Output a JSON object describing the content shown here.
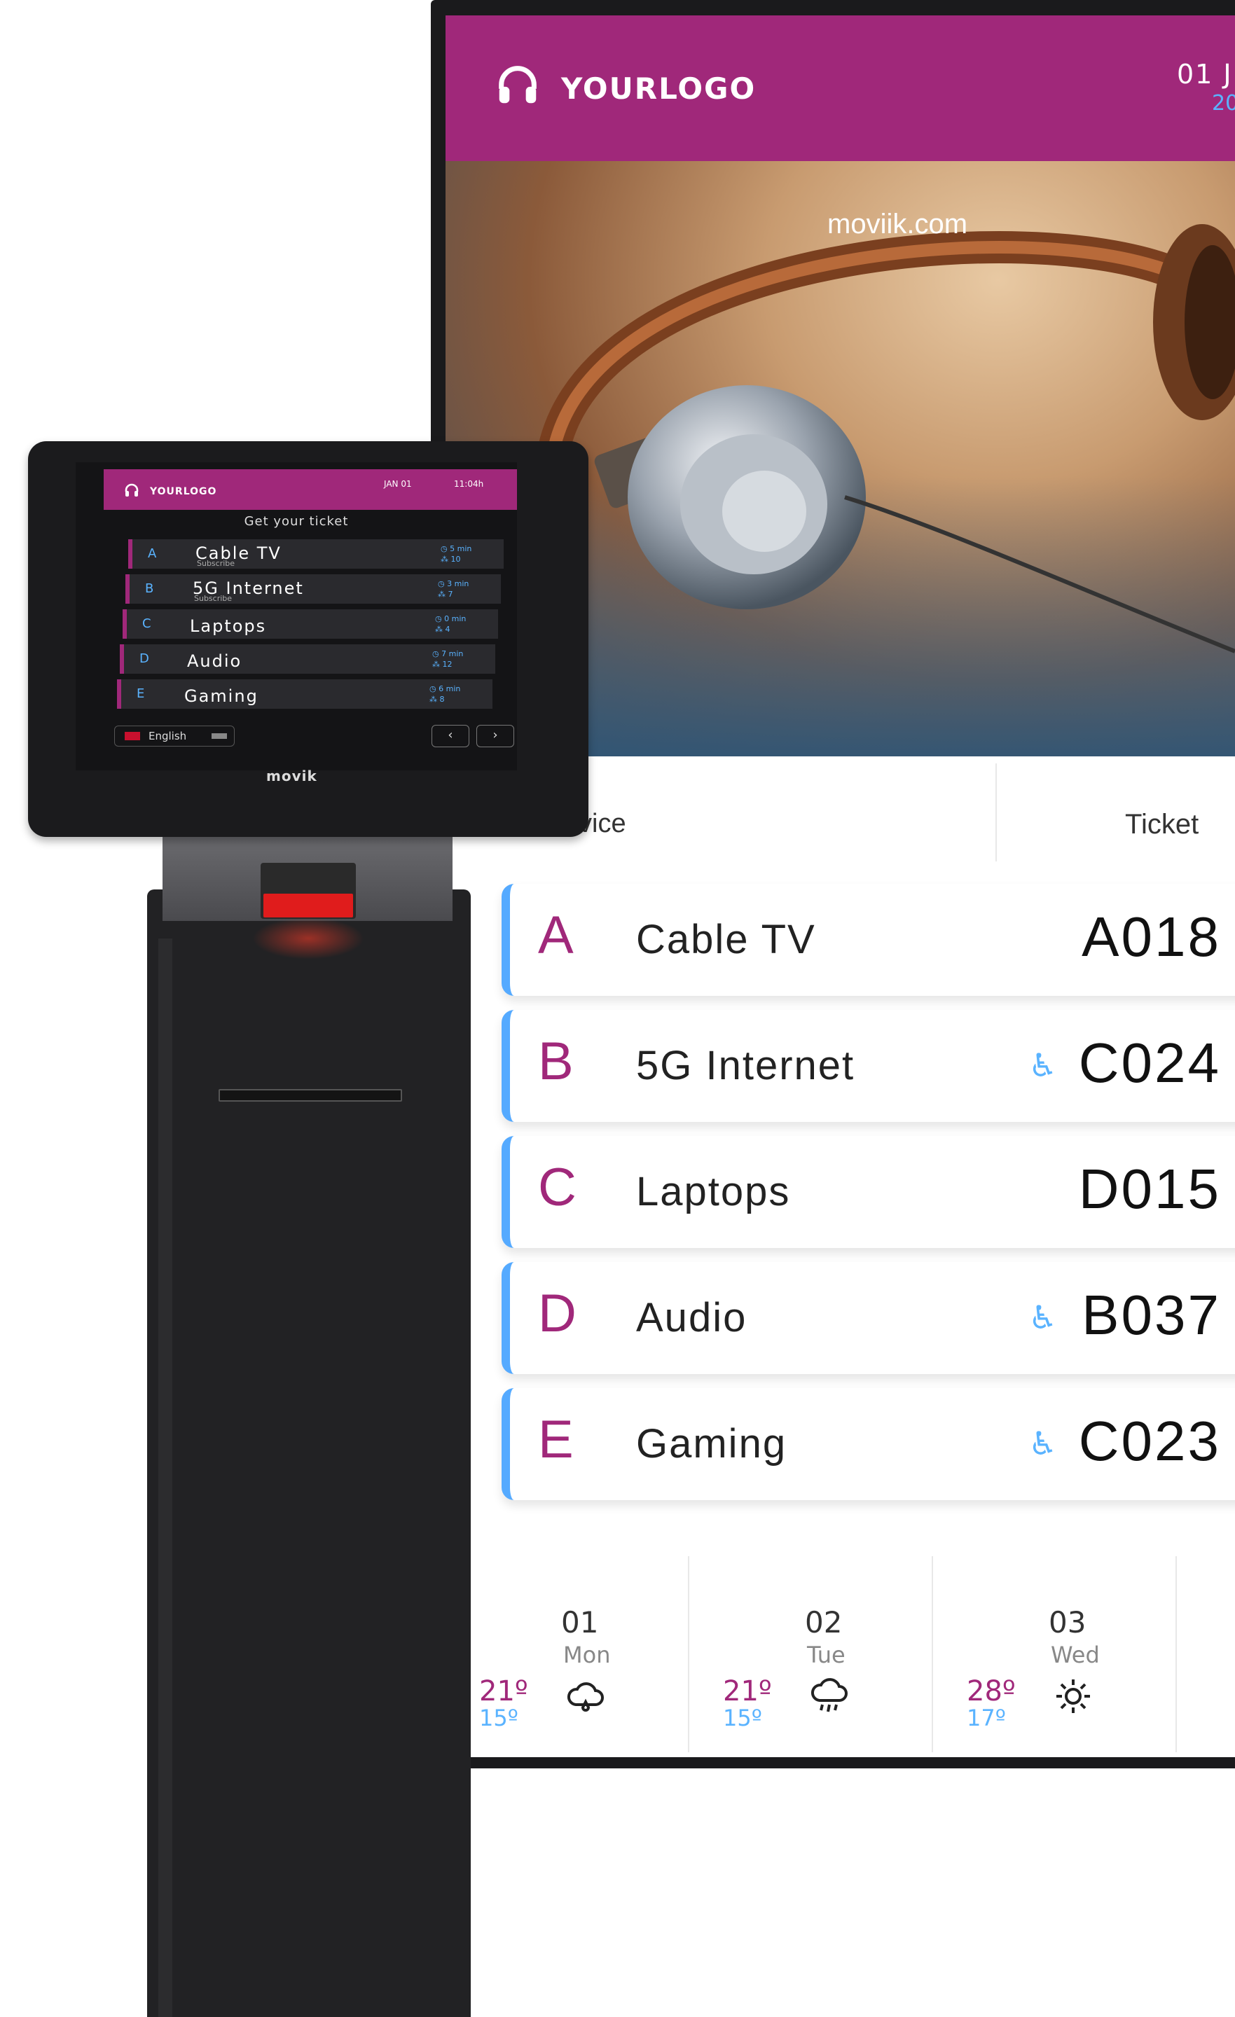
{
  "display": {
    "logo": "YOURLOGO",
    "date": "01 J",
    "year": "20",
    "watermark": "moviik.com",
    "col_service": "vice",
    "col_ticket": "Ticket",
    "rows": [
      {
        "letter": "A",
        "service": "Cable TV",
        "ticket": "A018",
        "accessible": false
      },
      {
        "letter": "B",
        "service": "5G Internet",
        "ticket": "C024",
        "accessible": true
      },
      {
        "letter": "C",
        "service": "Laptops",
        "ticket": "D015",
        "accessible": false
      },
      {
        "letter": "D",
        "service": "Audio",
        "ticket": "B037",
        "accessible": true
      },
      {
        "letter": "E",
        "service": "Gaming",
        "ticket": "C023",
        "accessible": true
      }
    ],
    "weather": [
      {
        "num": "01",
        "day": "Mon",
        "hi": "21º",
        "lo": "15º",
        "icon": "cloud-rain-icon"
      },
      {
        "num": "02",
        "day": "Tue",
        "hi": "21º",
        "lo": "15º",
        "icon": "cloud-showers-icon"
      },
      {
        "num": "03",
        "day": "Wed",
        "hi": "28º",
        "lo": "17º",
        "icon": "sun-icon"
      }
    ]
  },
  "kiosk": {
    "logo": "YOURLOGO",
    "date": "JAN 01",
    "time": "11:04h",
    "title": "Get your ticket",
    "rows": [
      {
        "letter": "A",
        "name": "Cable TV",
        "sub": "Subscribe",
        "wait": "5 min",
        "queue": "10"
      },
      {
        "letter": "B",
        "name": "5G Internet",
        "sub": "Subscribe",
        "wait": "3 min",
        "queue": "7"
      },
      {
        "letter": "C",
        "name": "Laptops",
        "sub": "",
        "wait": "0 min",
        "queue": "4"
      },
      {
        "letter": "D",
        "name": "Audio",
        "sub": "",
        "wait": "7 min",
        "queue": "12"
      },
      {
        "letter": "E",
        "name": "Gaming",
        "sub": "",
        "wait": "6 min",
        "queue": "8"
      }
    ],
    "language": "English",
    "prev": "‹",
    "next": "›",
    "brand": "movik"
  },
  "colors": {
    "brand": "#a0287a",
    "accent": "#5ab3ff"
  }
}
